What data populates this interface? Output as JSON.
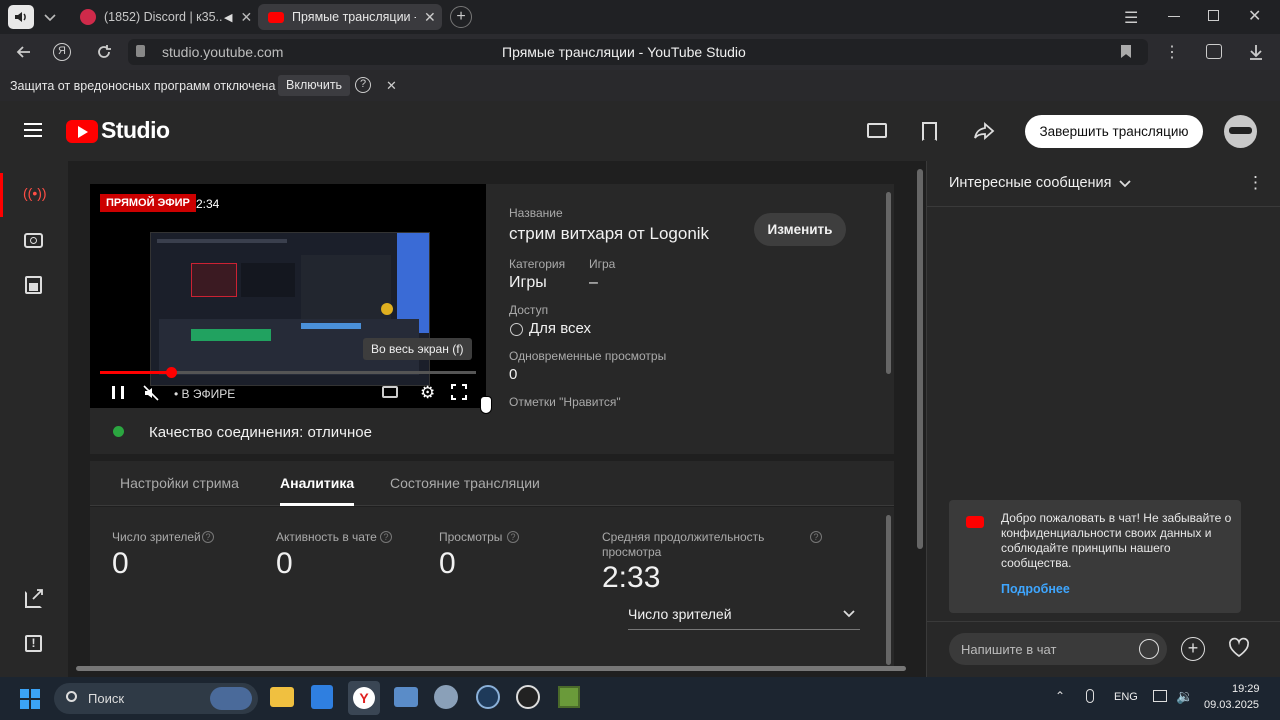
{
  "browser": {
    "tabs": [
      {
        "title": "(1852) Discord | к35..."
      },
      {
        "title": "Прямые трансляции - ..."
      }
    ],
    "url": "studio.youtube.com",
    "page_title": "Прямые трансляции - YouTube Studio",
    "warning_text": "Защита от вредоносных программ отключена",
    "warning_button": "Включить"
  },
  "header": {
    "logo_text": "Studio",
    "end_stream_label": "Завершить трансляцию"
  },
  "player": {
    "live_badge": "ПРЯМОЙ ЭФИР",
    "elapsed": "2:34",
    "live_label": "• В ЭФИРЕ",
    "tooltip": "Во весь экран (f)",
    "connection_text": "Качество соединения: отличное"
  },
  "details": {
    "name_label": "Название",
    "name_value": "стрим витхаря от Logonik",
    "edit_button": "Изменить",
    "category_label": "Категория",
    "category_value": "Игры",
    "game_label": "Игра",
    "game_value": "–",
    "access_label": "Доступ",
    "access_value": "Для всех",
    "concurrent_label": "Одновременные просмотры",
    "concurrent_value": "0",
    "likes_label": "Отметки \"Нравится\""
  },
  "tabs": [
    "Настройки стрима",
    "Аналитика",
    "Состояние трансляции"
  ],
  "analytics": {
    "viewers_label": "Число зрителей",
    "viewers_value": "0",
    "chat_activity_label": "Активность в чате",
    "chat_activity_value": "0",
    "views_label": "Просмотры",
    "views_value": "0",
    "avg_duration_label_1": "Средняя продолжительность",
    "avg_duration_label_2": "просмотра",
    "avg_duration_value": "2:33",
    "dropdown_value": "Число зрителей"
  },
  "chat": {
    "mode_label": "Интересные сообщения",
    "welcome_text": "Добро пожаловать в чат! Не забывайте о конфиденциальности своих данных и соблюдайте принципы нашего сообщества.",
    "learn_more": "Подробнее",
    "input_placeholder": "Напишите в чат"
  },
  "taskbar": {
    "search_placeholder": "Поиск",
    "lang": "ENG",
    "time": "19:29",
    "date": "09.03.2025"
  },
  "colors": {
    "live_red": "#cc0000",
    "youtube_red": "#ff0000",
    "status_green": "#2ba640",
    "link_blue": "#3ea6ff"
  }
}
